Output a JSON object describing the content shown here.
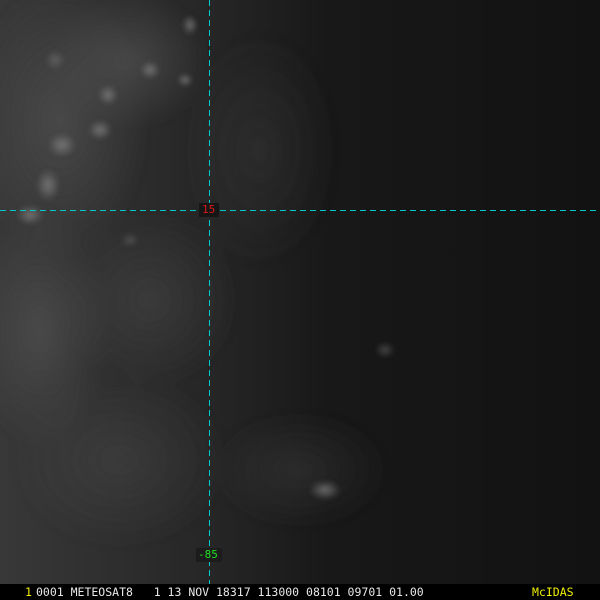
{
  "overlay": {
    "latitude_label": "15",
    "longitude_label": "-85",
    "gridline_color": "#00C8C8",
    "latitude_label_color": "#E01818",
    "longitude_label_color": "#20E020"
  },
  "status_bar": {
    "frame_number": "1",
    "frame_info": "0001 METEOSAT8   1 13 NOV 18317 113000 08101 09701 01.00",
    "brand": "McIDAS",
    "frame_number_color": "#F0F000",
    "frame_info_color": "#E8E8E8",
    "brand_color": "#F0F000"
  }
}
